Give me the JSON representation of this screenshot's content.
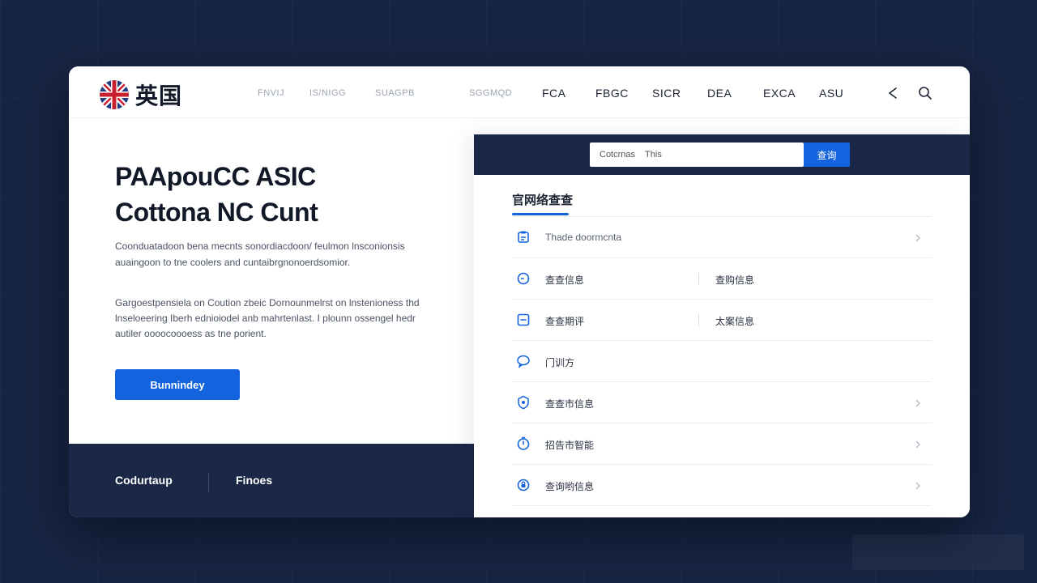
{
  "header": {
    "logo_text": "英国",
    "nav_muted": [
      "FNVIJ",
      "IS/NIGG",
      "SUAGPB",
      "SGGMQD"
    ],
    "nav_dark": [
      "FCA",
      "FBGC",
      "SICR",
      "DEA",
      "EXCA",
      "ASU"
    ]
  },
  "hero": {
    "title_line1": "PAApouCC ASIC",
    "title_line2": "Cottona NC Cunt",
    "desc": "Coonduatadoon bena mecnts sonordiacdoon/ feulmon lnsconionsis auaingoon to tne coolers and cuntaibrgnonoerdsomior.",
    "desc2": "Gargoestpensiela on Coution zbeic Dornounmelrst on lnstenioness thd lnseloeering Iberh ednioiodel anb mahrtenlast. I plounn ossengel hedr autiler oooocoooess as tne porient.",
    "cta_label": "Bunnindey"
  },
  "footer": {
    "link1": "Codurtaup",
    "link2": "Finoes"
  },
  "panel": {
    "search_value": "Cotcrnas    This",
    "search_button": "查询",
    "section_title": "官网络查查",
    "rows": [
      {
        "label": "Thade doormcnta",
        "label2": "",
        "chevron": true
      },
      {
        "label": "查查信息",
        "label2": "查购信息",
        "chevron": false
      },
      {
        "label": "查查期评",
        "label2": "太案信息",
        "chevron": false
      },
      {
        "label": "门训方",
        "label2": "",
        "chevron": false
      },
      {
        "label": "查查市信息",
        "label2": "",
        "chevron": true
      },
      {
        "label": "招告市智能",
        "label2": "",
        "chevron": true
      },
      {
        "label": "查询哟信息",
        "label2": "",
        "chevron": true
      }
    ]
  },
  "colors": {
    "accent": "#1363df",
    "navy": "#1a2746",
    "background": "#172544"
  },
  "icons": [
    "uk-flag-icon",
    "share-icon",
    "search-icon",
    "document-icon",
    "clock-icon",
    "minus-square-icon",
    "chat-bubble-icon",
    "shield-icon",
    "timer-icon",
    "lock-circle-icon",
    "chevron-right-icon"
  ]
}
